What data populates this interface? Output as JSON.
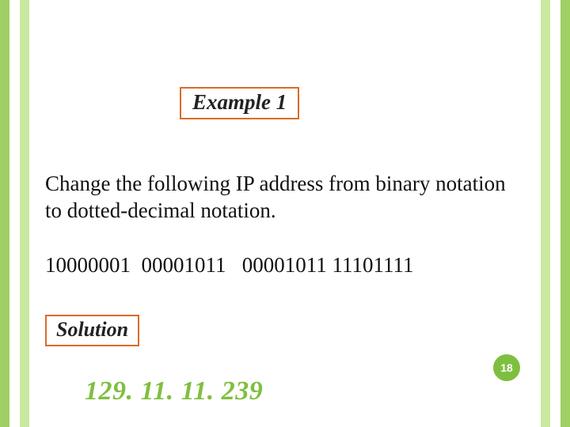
{
  "slide": {
    "example_label": "Example 1",
    "body": "Change the following IP address from binary notation to dotted-decimal notation.",
    "binary": "10000001  00001011   00001011 11101111",
    "solution_label": "Solution",
    "answer": "129. 11. 11. 239",
    "page_number": "18"
  },
  "colors": {
    "accent_border": "#d96b2a",
    "stripe_outer": "#9fd063",
    "stripe_inner": "#c9e8a0",
    "answer_green": "#7fbf3f"
  }
}
